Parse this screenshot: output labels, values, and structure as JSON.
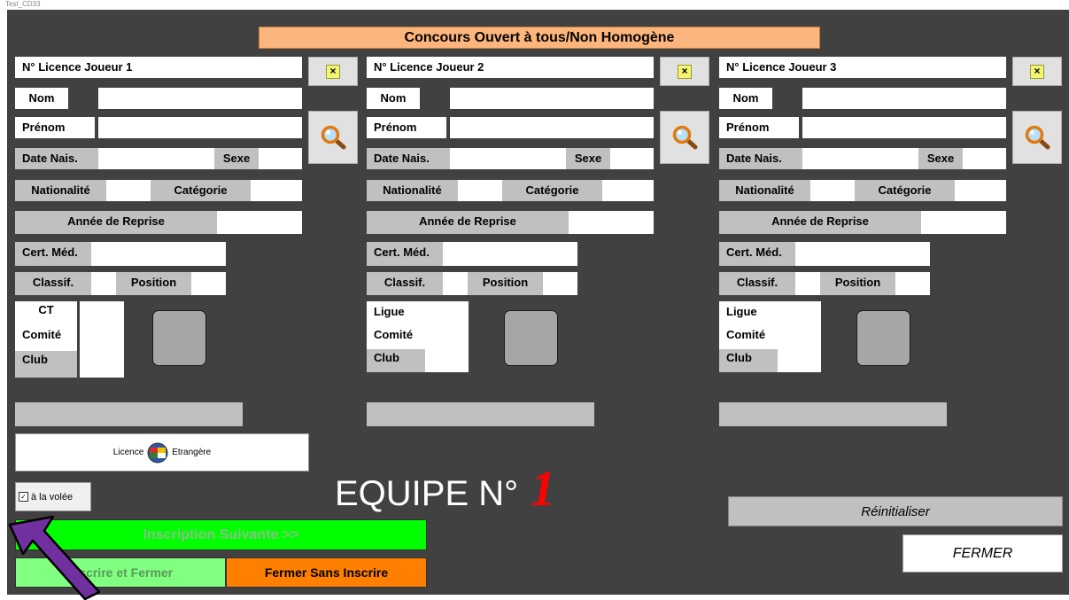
{
  "window": {
    "title": "Test_CD33"
  },
  "header": {
    "title": "Concours Ouvert à tous/Non Homogène"
  },
  "players": [
    {
      "licence_label": "N° Licence Joueur 1",
      "nom": "Nom",
      "prenom": "Prénom",
      "date_nais": "Date Nais.",
      "sexe": "Sexe",
      "nationalite": "Nationalité",
      "categorie": "Catégorie",
      "annee_reprise": "Année de Reprise",
      "cert_med": "Cert. Méd.",
      "classif": "Classif.",
      "position": "Position",
      "org1": "CT",
      "org2": "Comité",
      "org3": "Club"
    },
    {
      "licence_label": "N° Licence Joueur 2",
      "nom": "Nom",
      "prenom": "Prénom",
      "date_nais": "Date Nais.",
      "sexe": "Sexe",
      "nationalite": "Nationalité",
      "categorie": "Catégorie",
      "annee_reprise": "Année de Reprise",
      "cert_med": "Cert. Méd.",
      "classif": "Classif.",
      "position": "Position",
      "org1": "Ligue",
      "org2": "Comité",
      "org3": "Club"
    },
    {
      "licence_label": "N° Licence Joueur 3",
      "nom": "Nom",
      "prenom": "Prénom",
      "date_nais": "Date Nais.",
      "sexe": "Sexe",
      "nationalite": "Nationalité",
      "categorie": "Catégorie",
      "annee_reprise": "Année de Reprise",
      "cert_med": "Cert. Méd.",
      "classif": "Classif.",
      "position": "Position",
      "org1": "Ligue",
      "org2": "Comité",
      "org3": "Club"
    }
  ],
  "icons": {
    "clear": "clear-x-icon",
    "search": "magnifier-icon",
    "flags": "world-flags-icon",
    "checkbox": "check-icon"
  },
  "licence_etrangere": {
    "left": "Licence",
    "right": "Etrangère"
  },
  "checkbox": {
    "label": "à la volée",
    "checked": true,
    "mark": "✓"
  },
  "team": {
    "label": "EQUIPE N°",
    "number": "1"
  },
  "buttons": {
    "inscription_suivante": "Inscription Suivante >>",
    "inscrire_fermer": "Inscrire et Fermer",
    "fermer_sans_inscrire": "Fermer Sans Inscrire",
    "reinitialiser": "Réinitialiser",
    "fermer": "FERMER"
  },
  "colors": {
    "background": "#414141",
    "header": "#fcb57c",
    "suivante": "#00ff00",
    "inscrire_fermer": "#80ff80",
    "fermer_sans": "#ff8000",
    "team_number": "#ff0000",
    "arrow": "#7030a0"
  }
}
